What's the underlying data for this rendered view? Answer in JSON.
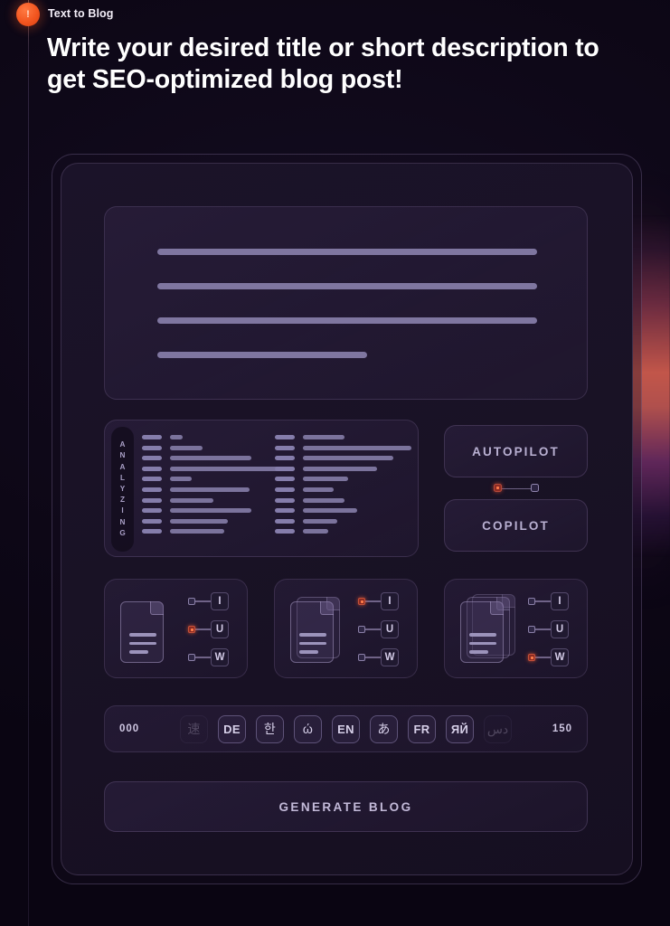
{
  "header": {
    "badge_icon": "exclamation-badge",
    "badge_text": "!",
    "eyebrow": "Text to Blog",
    "headline": "Write your desired title or short description to get SEO-optimized blog post!"
  },
  "colors": {
    "accent_orange": "#f2551f",
    "edge_glow": "#c2564a",
    "page_bg": "#0d0716",
    "card_bg": "#191225",
    "panel_border": "#9680b2",
    "text_primary": "#ffffff",
    "text_muted": "#b9b0d2",
    "bar_fill": "#7f76a0",
    "node_active": "#ff7a4a"
  },
  "editor": {
    "placeholder_lines": [
      100,
      100,
      100,
      55
    ]
  },
  "analyzing": {
    "label": "ANALYZING",
    "letters": [
      "A",
      "N",
      "A",
      "L",
      "Y",
      "Z",
      "I",
      "N",
      "G"
    ],
    "columns": [
      {
        "name": "left",
        "rows": [
          14,
          36,
          90,
          138,
          24,
          88,
          48,
          90,
          64,
          60
        ]
      },
      {
        "name": "right",
        "rows": [
          46,
          120,
          100,
          82,
          50,
          34,
          46,
          60,
          38,
          28
        ]
      }
    ]
  },
  "mode": {
    "autopilot_label": "AUTOPILOT",
    "copilot_label": "COPILOT",
    "connector_nodes": [
      {
        "name": "autopilot-node",
        "active": true
      },
      {
        "name": "copilot-node",
        "active": false
      }
    ]
  },
  "doc_cards": [
    {
      "name": "single-page-card",
      "pages": 1,
      "formats": [
        {
          "label": "I",
          "active": false
        },
        {
          "label": "U",
          "active": true
        },
        {
          "label": "W",
          "active": false
        }
      ]
    },
    {
      "name": "double-page-card",
      "pages": 2,
      "formats": [
        {
          "label": "I",
          "active": true
        },
        {
          "label": "U",
          "active": false
        },
        {
          "label": "W",
          "active": false
        }
      ]
    },
    {
      "name": "triple-page-card",
      "pages": 3,
      "formats": [
        {
          "label": "I",
          "active": false
        },
        {
          "label": "U",
          "active": false
        },
        {
          "label": "W",
          "active": true
        }
      ]
    }
  ],
  "language_bar": {
    "min_count": "000",
    "max_count": "150",
    "chips": [
      {
        "label": "速",
        "dim": true,
        "cjk": true
      },
      {
        "label": "DE",
        "dim": false,
        "cjk": false
      },
      {
        "label": "한",
        "dim": false,
        "cjk": true
      },
      {
        "label": "ώ",
        "dim": false,
        "cjk": true
      },
      {
        "label": "EN",
        "dim": false,
        "cjk": false
      },
      {
        "label": "あ",
        "dim": false,
        "cjk": true
      },
      {
        "label": "FR",
        "dim": false,
        "cjk": false
      },
      {
        "label": "ЯЙ",
        "dim": false,
        "cjk": false
      },
      {
        "label": "دس",
        "dim": true,
        "cjk": true
      }
    ]
  },
  "generate": {
    "label": "GENERATE BLOG"
  }
}
